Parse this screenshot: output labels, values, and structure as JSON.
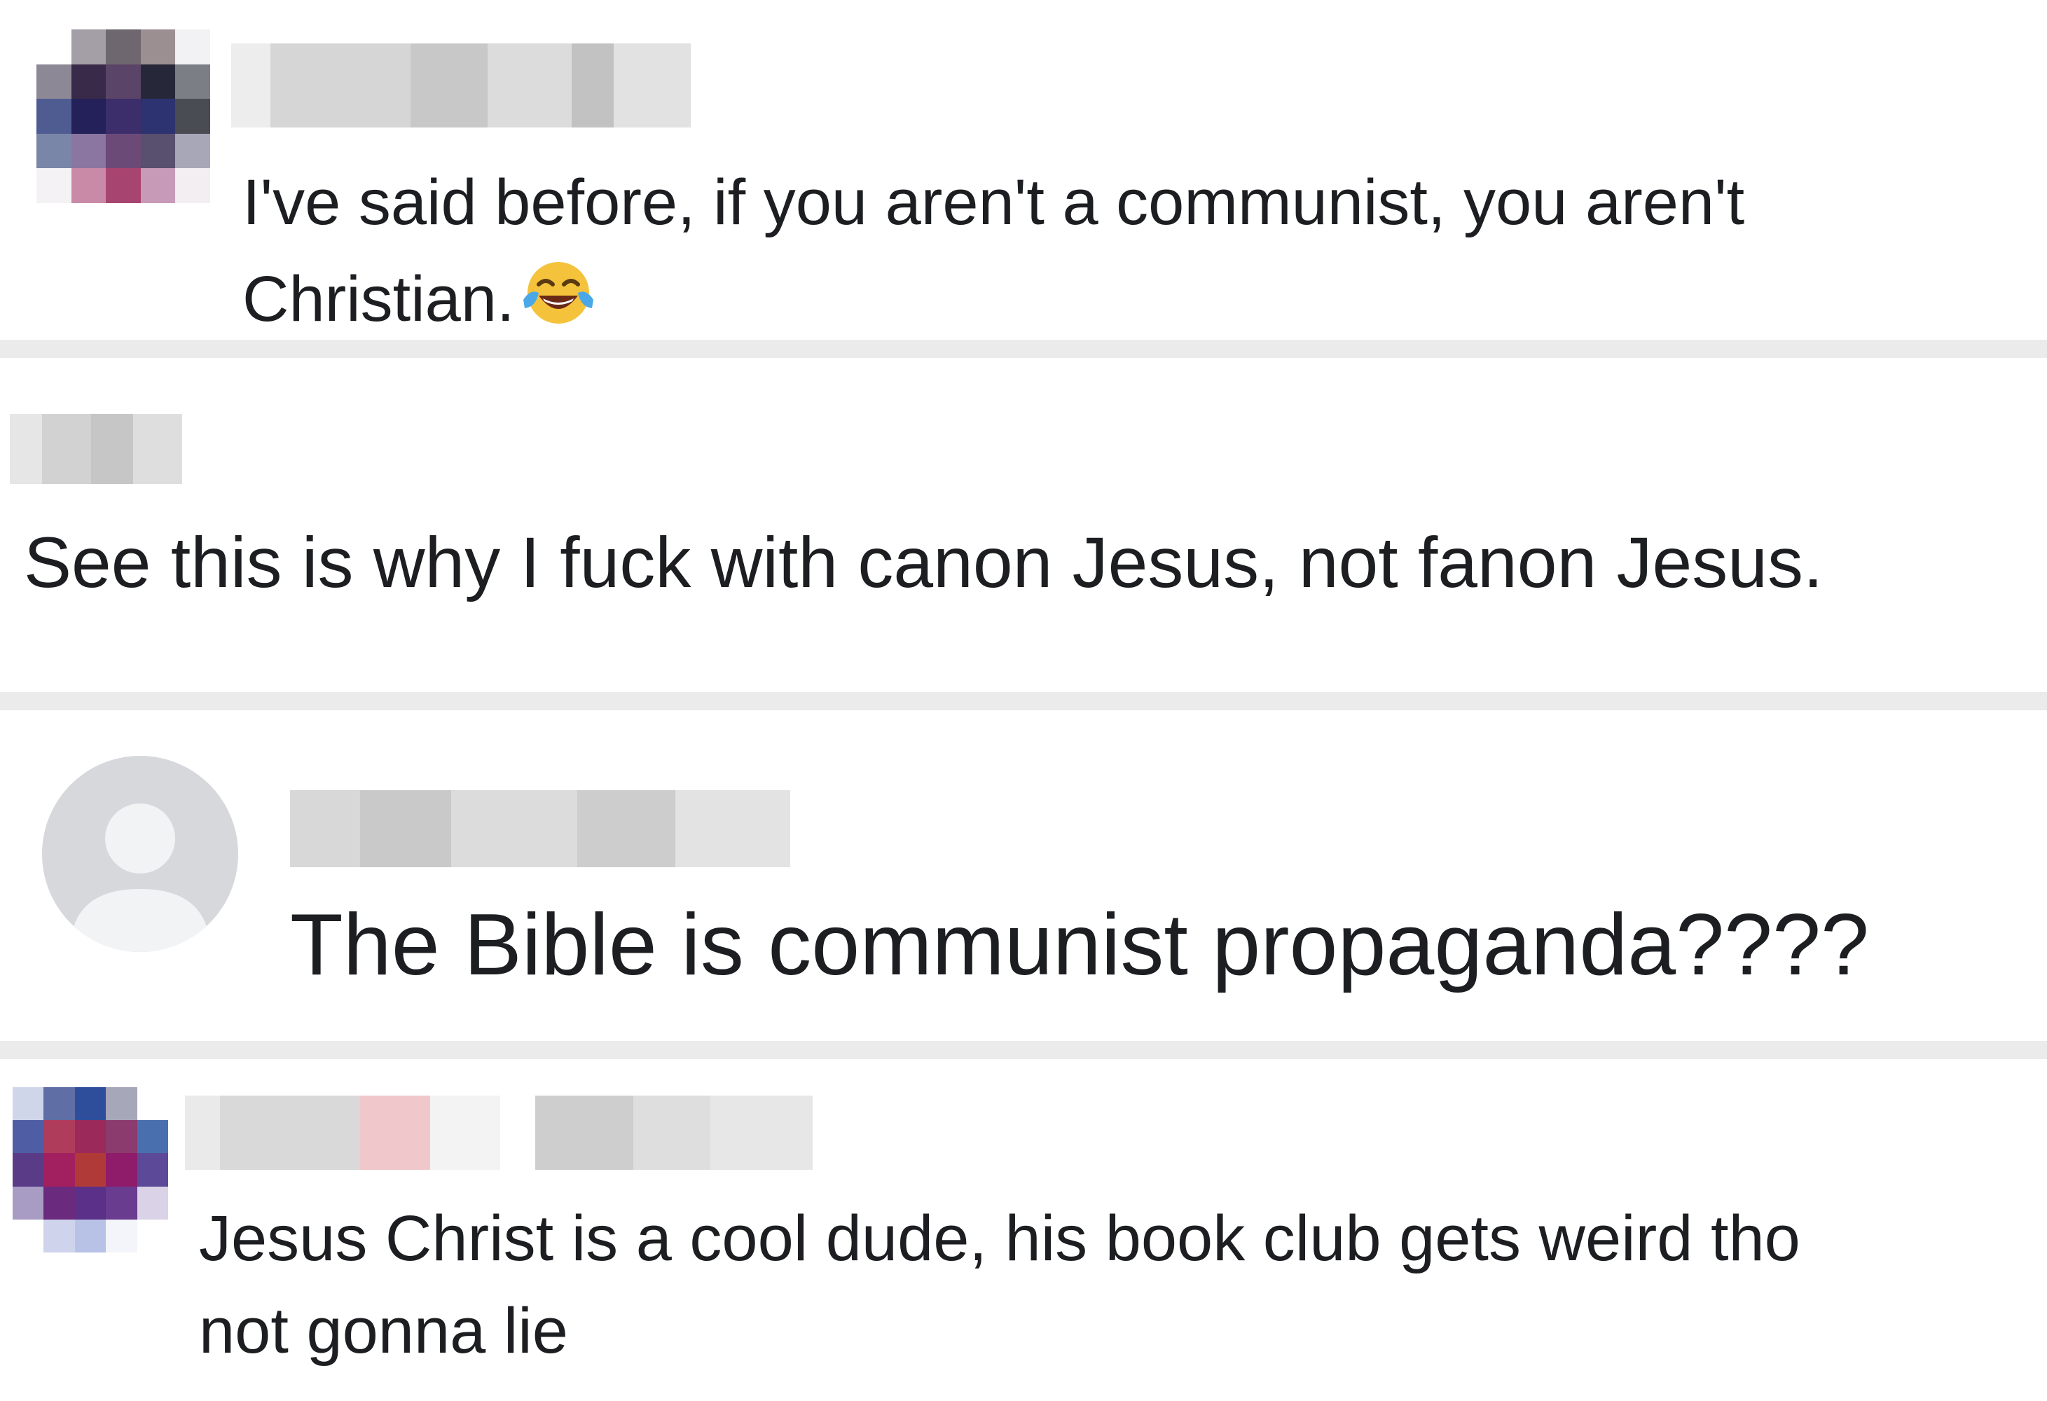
{
  "comments": [
    {
      "text_line_1": "I've said before, if you aren't a communist, you aren't",
      "text_line_2": "Christian.",
      "emoji": "face-with-tears-of-joy"
    },
    {
      "text": "See this is why I fuck with canon Jesus, not fanon Jesus."
    },
    {
      "text": "The Bible is communist propaganda????"
    },
    {
      "text_line_1": "Jesus Christ is a cool dude, his book club gets weird tho",
      "text_line_2": "not gonna lie"
    }
  ],
  "colors": {
    "text": "#1c1e21",
    "separator": "#ebebeb",
    "default_avatar_bg": "#d7d8dc",
    "default_avatar_fg": "#f2f3f5",
    "blur_light": "#e4e4e4",
    "blur_mid": "#cfcfcf"
  }
}
